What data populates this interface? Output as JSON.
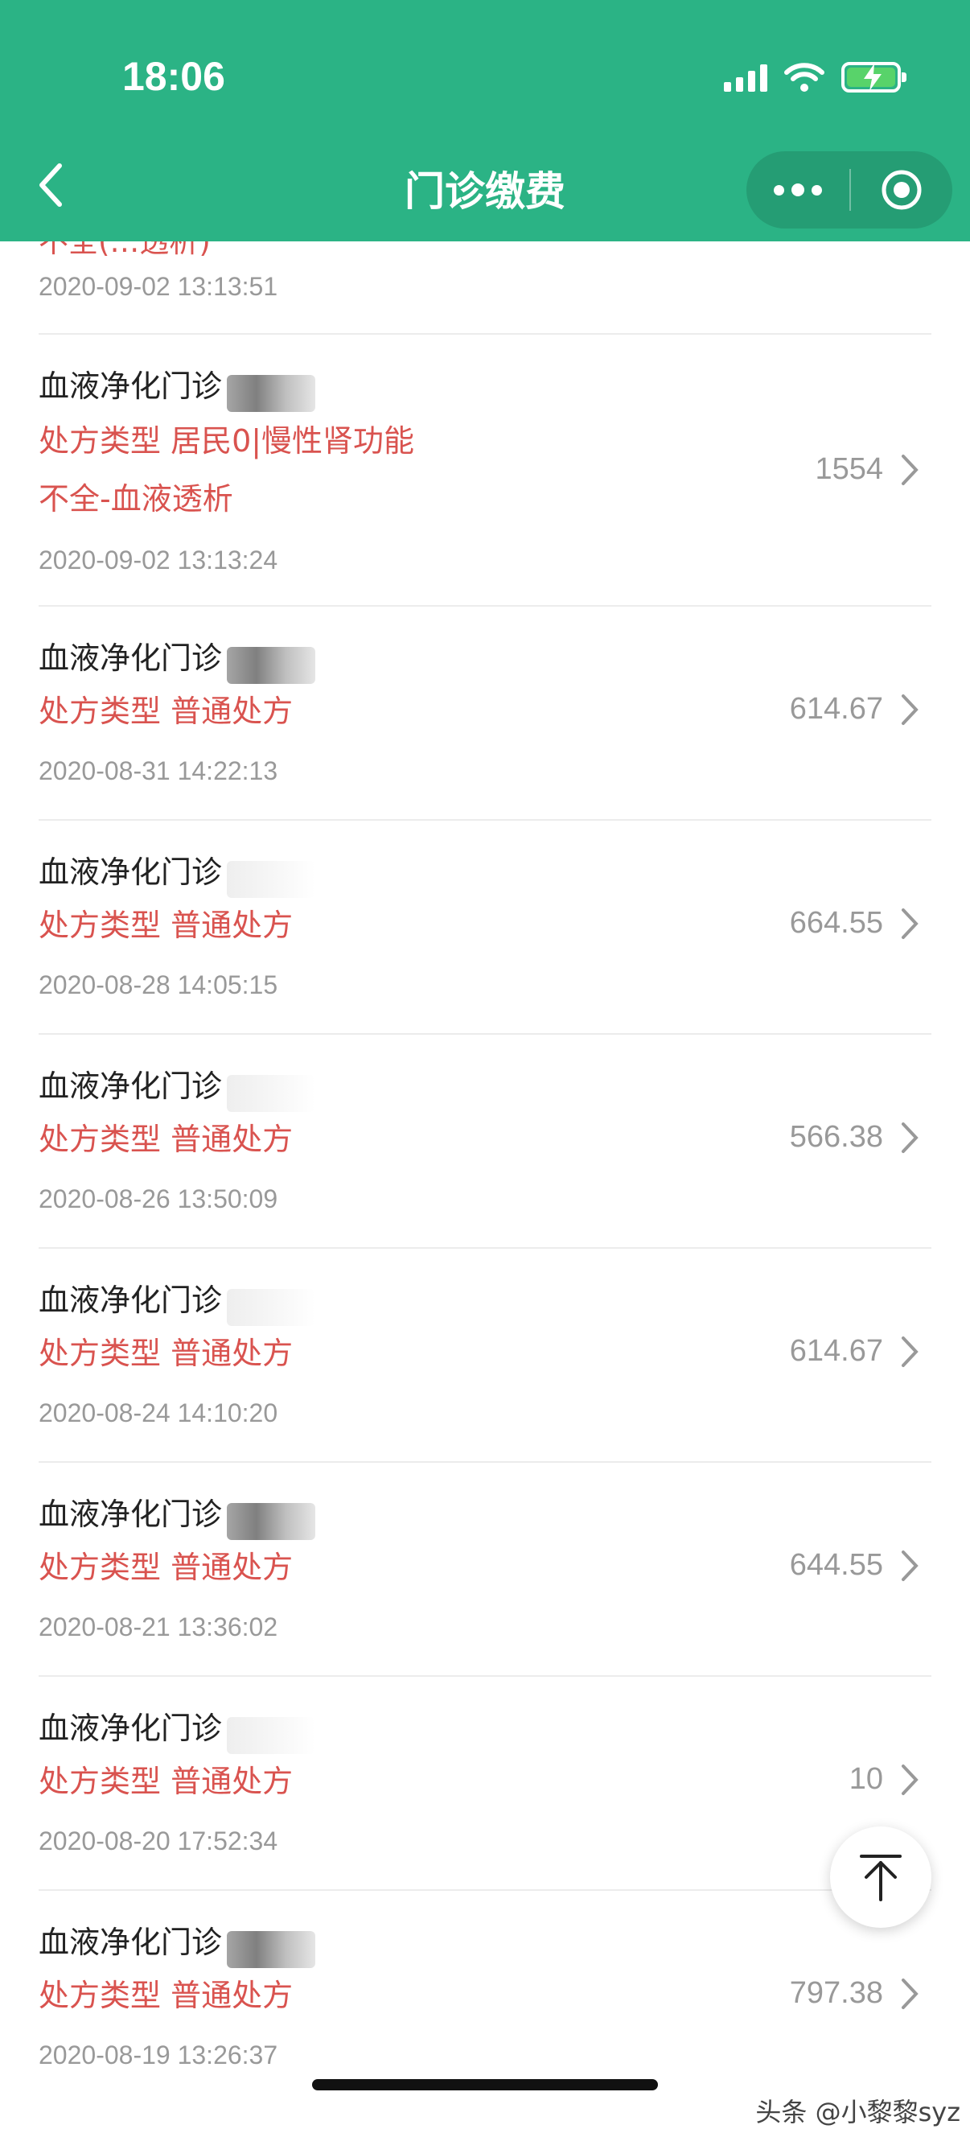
{
  "status_bar": {
    "time": "18:06"
  },
  "nav": {
    "title": "门诊缴费"
  },
  "partial_row": {
    "text_cut": "不全(…透析)",
    "date": "2020-09-02 13:13:51"
  },
  "rows": [
    {
      "title": "血液净化门诊",
      "ptype_line1": "处方类型 居民0|慢性肾功能",
      "ptype_line2": "不全-血液透析",
      "date": "2020-09-02 13:13:24",
      "amount": "1554"
    },
    {
      "title": "血液净化门诊",
      "ptype_line1": "处方类型 普通处方",
      "date": "2020-08-31 14:22:13",
      "amount": "614.67"
    },
    {
      "title": "血液净化门诊",
      "ptype_line1": "处方类型 普通处方",
      "date": "2020-08-28 14:05:15",
      "amount": "664.55"
    },
    {
      "title": "血液净化门诊",
      "ptype_line1": "处方类型 普通处方",
      "date": "2020-08-26 13:50:09",
      "amount": "566.38"
    },
    {
      "title": "血液净化门诊",
      "ptype_line1": "处方类型 普通处方",
      "date": "2020-08-24 14:10:20",
      "amount": "614.67"
    },
    {
      "title": "血液净化门诊",
      "ptype_line1": "处方类型 普通处方",
      "date": "2020-08-21 13:36:02",
      "amount": "644.55"
    },
    {
      "title": "血液净化门诊",
      "ptype_line1": "处方类型 普通处方",
      "date": "2020-08-20 17:52:34",
      "amount": "10"
    },
    {
      "title": "血液净化门诊",
      "ptype_line1": "处方类型 普通处方",
      "date": "2020-08-19 13:26:37",
      "amount": "797.38"
    }
  ],
  "watermark": "头条 @小黎黎syz",
  "colors": {
    "header": "#2bb385",
    "ptype": "#d9534f",
    "muted": "#999999"
  }
}
